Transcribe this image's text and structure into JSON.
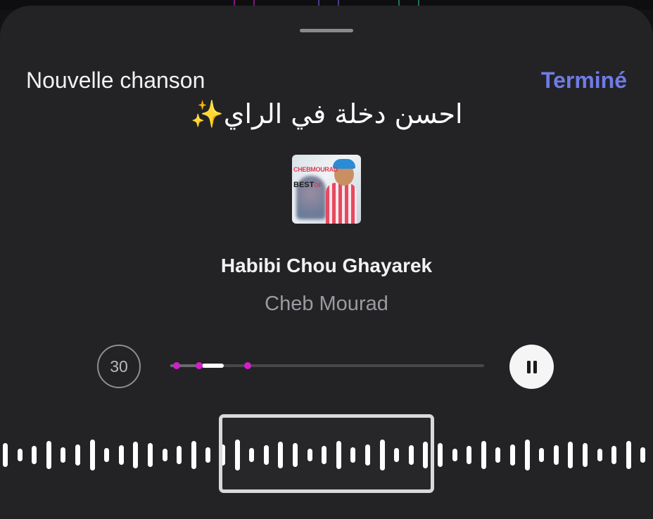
{
  "header": {
    "title": "Nouvelle chanson",
    "done_label": "Terminé"
  },
  "caption": {
    "text": "احسن دخلة في الراي",
    "emoji": "✨"
  },
  "artwork": {
    "banner_text": "CHEBMOURAD",
    "best_text": "BEST",
    "of_text": "OF"
  },
  "track": {
    "title": "Habibi Chou Ghayarek",
    "artist": "Cheb Mourad"
  },
  "controls": {
    "skip_label": "30",
    "pause_icon": "pause-icon"
  },
  "scrubber": {
    "played_fraction": 0.17,
    "window_start_fraction": 0.1,
    "window_end_fraction": 0.17,
    "marker_fractions": [
      0.02,
      0.093,
      0.247
    ]
  },
  "colors": {
    "accent": "#6f7ce6",
    "marker": "#d41ecb",
    "sheet_background": "#232326"
  }
}
